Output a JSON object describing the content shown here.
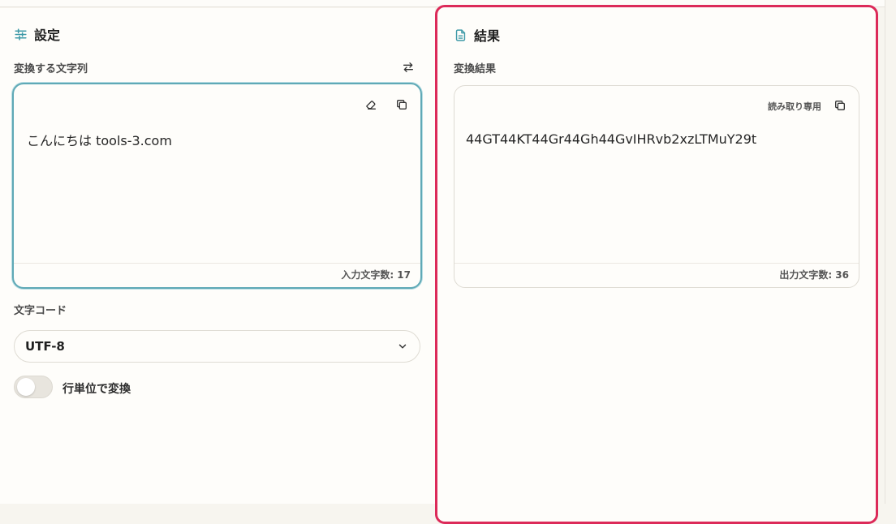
{
  "settings": {
    "heading": "設定",
    "input_label": "変換する文字列",
    "input_value": "こんにちは tools-3.com",
    "input_count": "入力文字数: 17",
    "encoding_label": "文字コード",
    "encoding_value": "UTF-8",
    "line_mode_label": "行単位で変換",
    "line_mode_on": false
  },
  "result": {
    "heading": "結果",
    "output_label": "変換結果",
    "readonly": "読み取り専用",
    "output_value": "44GT44KT44Gr44Gh44GvIHRvb2xzLTMuY29t",
    "output_count": "出力文字数: 36"
  },
  "colors": {
    "accent_teal": "#3f9aa8",
    "result_border": "#dc2a59"
  },
  "icons": {
    "settings": "sliders-icon",
    "swap": "swap-arrows-icon",
    "clear": "eraser-icon",
    "copy": "copy-icon",
    "result": "document-icon",
    "dropdown": "chevron-down-icon"
  }
}
